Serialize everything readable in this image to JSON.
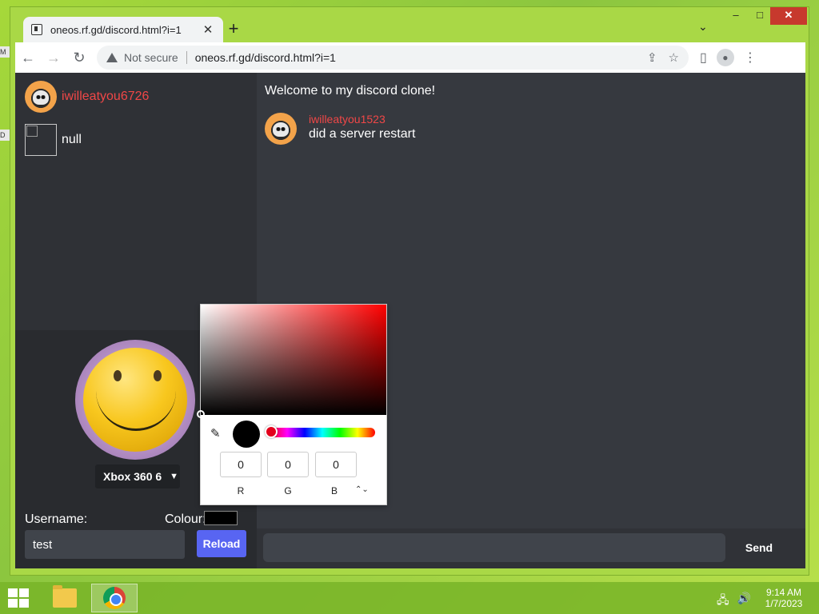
{
  "desktop": {
    "stub1": "M",
    "stub2": "D"
  },
  "browser": {
    "tab_title": "oneos.rf.gd/discord.html?i=1",
    "tab_close": "✕",
    "new_tab": "+",
    "tab_search": "⌄",
    "window_controls": {
      "minimize": "–",
      "maximize": "□",
      "close": "✕"
    },
    "nav": {
      "back": "←",
      "forward": "→",
      "reload": "↻"
    },
    "security_label": "Not secure",
    "url": "oneos.rf.gd/discord.html?i=1",
    "omni_icons": {
      "share": "⇪",
      "bookmark": "☆"
    },
    "toolbar_icons": {
      "sidepanel": "▯",
      "profile": "👤",
      "menu": "⋮"
    }
  },
  "sidebar": {
    "users": [
      {
        "name": "iwilleatyou6726",
        "avatar": "skull-avatar"
      },
      {
        "name": "null",
        "avatar": "broken-image"
      }
    ]
  },
  "profile": {
    "avatar": "smiley-avatar",
    "avatar_select": "Xbox 360 6",
    "username_label": "Username:",
    "colour_label": "Colour:",
    "username_value": "test",
    "colour_value": "#000000",
    "reload_label": "Reload"
  },
  "chat": {
    "welcome": "Welcome to my discord clone!",
    "messages": [
      {
        "user": "iwilleatyou1523",
        "text": "did a server restart",
        "avatar": "skull-avatar"
      }
    ],
    "input_placeholder": "",
    "send_label": "Send"
  },
  "color_picker": {
    "hue_color": "#ff0000",
    "current_color": "#000000",
    "r": "0",
    "g": "0",
    "b": "0",
    "labels": {
      "r": "R",
      "g": "G",
      "b": "B"
    },
    "format_toggle": "⌃⌄",
    "eyedropper": "✎"
  },
  "taskbar": {
    "apps": [
      {
        "name": "File Explorer",
        "icon": "folder-icon"
      },
      {
        "name": "Google Chrome",
        "icon": "chrome-icon",
        "active": true
      }
    ],
    "tray_icons": {
      "network": "🖧",
      "volume": "🔊"
    },
    "time": "9:14 AM",
    "date": "1/7/2023"
  },
  "colors": {
    "accent": "#5865f2",
    "username_red": "#f04747",
    "chat_bg": "#36393f",
    "sidebar_bg": "#2f3136"
  }
}
